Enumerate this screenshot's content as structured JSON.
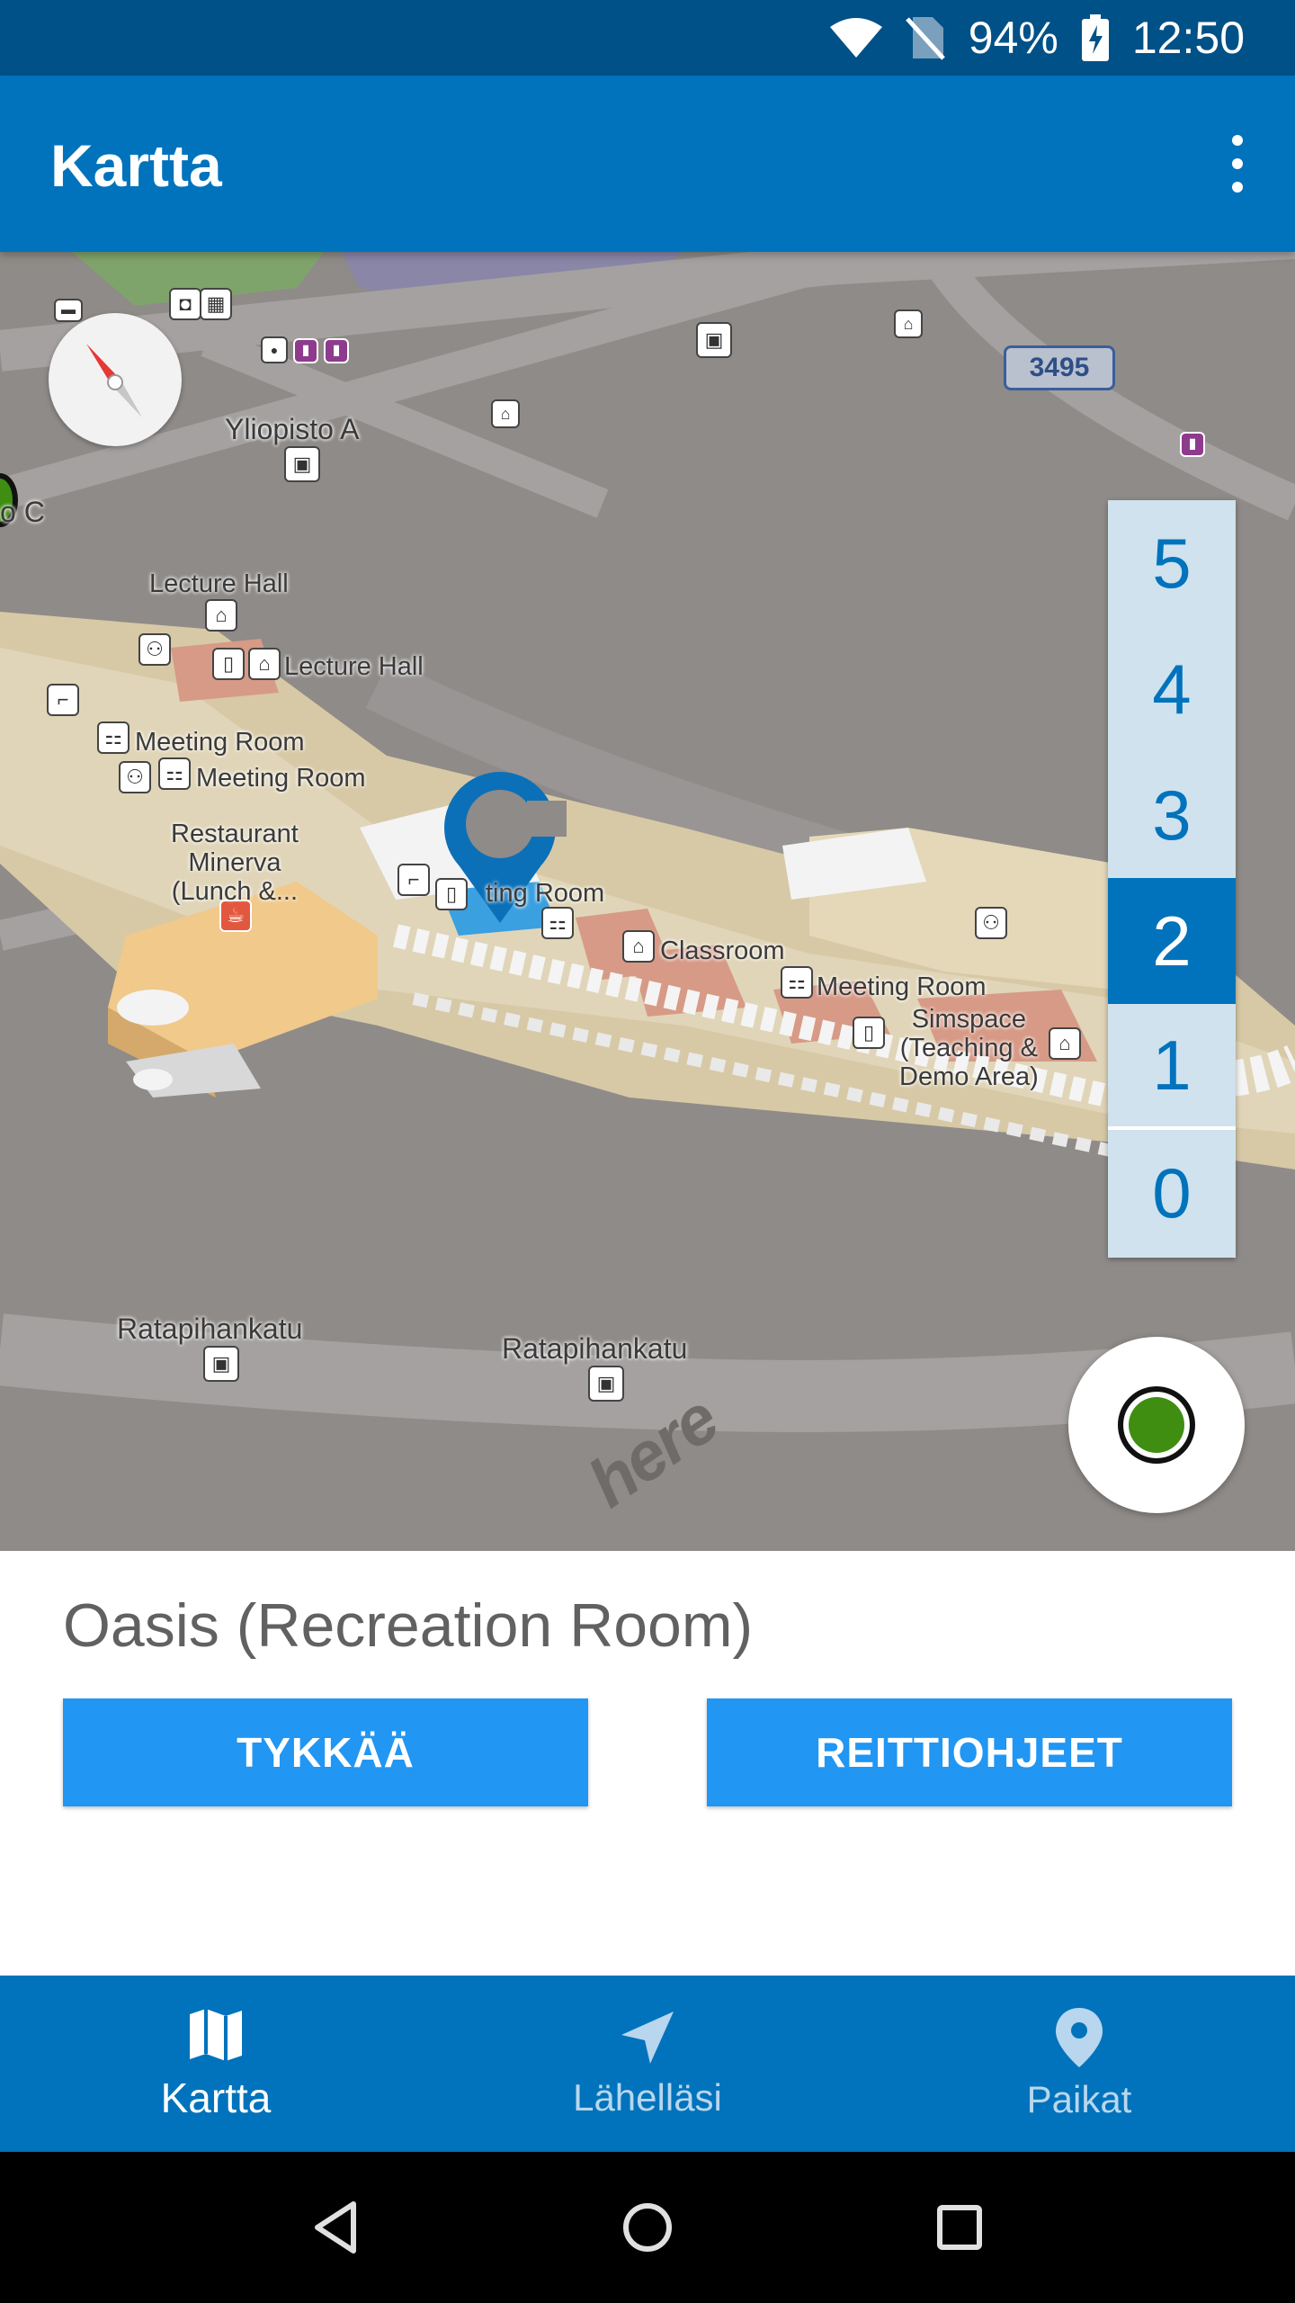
{
  "status_bar": {
    "battery": "94%",
    "time": "12:50"
  },
  "app_bar": {
    "title": "Kartta"
  },
  "map": {
    "labels": {
      "yliopisto_a": "Yliopisto A",
      "partial_c": "o C",
      "lecture_hall_1": "Lecture Hall",
      "lecture_hall_2": "Lecture Hall",
      "meeting_room_1": "Meeting Room",
      "meeting_room_2": "Meeting Room",
      "meeting_room_3": "ting Room",
      "meeting_room_4": "Meeting Room",
      "restaurant": "Restaurant\nMinerva\n(Lunch &...",
      "classroom": "Classroom",
      "simspace": "Simspace\n(Teaching &\nDemo Area)",
      "street_1": "Ratapihankatu",
      "street_2": "Ratapihankatu"
    },
    "road_number": "3495",
    "brand": "here"
  },
  "floor_picker": {
    "floors": [
      "5",
      "4",
      "3",
      "2",
      "1",
      "0"
    ],
    "selected": "2"
  },
  "place": {
    "title": "Oasis (Recreation Room)",
    "like_label": "TYKKÄÄ",
    "route_label": "REITTIOHJEET"
  },
  "bottom_nav": {
    "items": [
      {
        "label": "Kartta",
        "icon": "map-icon",
        "active": true
      },
      {
        "label": "Lähelläsi",
        "icon": "navigation-arrow-icon",
        "active": false
      },
      {
        "label": "Paikat",
        "icon": "place-pin-icon",
        "active": false
      }
    ]
  },
  "colors": {
    "primary": "#0073bc",
    "primary_dark": "#005187",
    "button": "#2196f3",
    "location_dot": "#3f8e12"
  }
}
